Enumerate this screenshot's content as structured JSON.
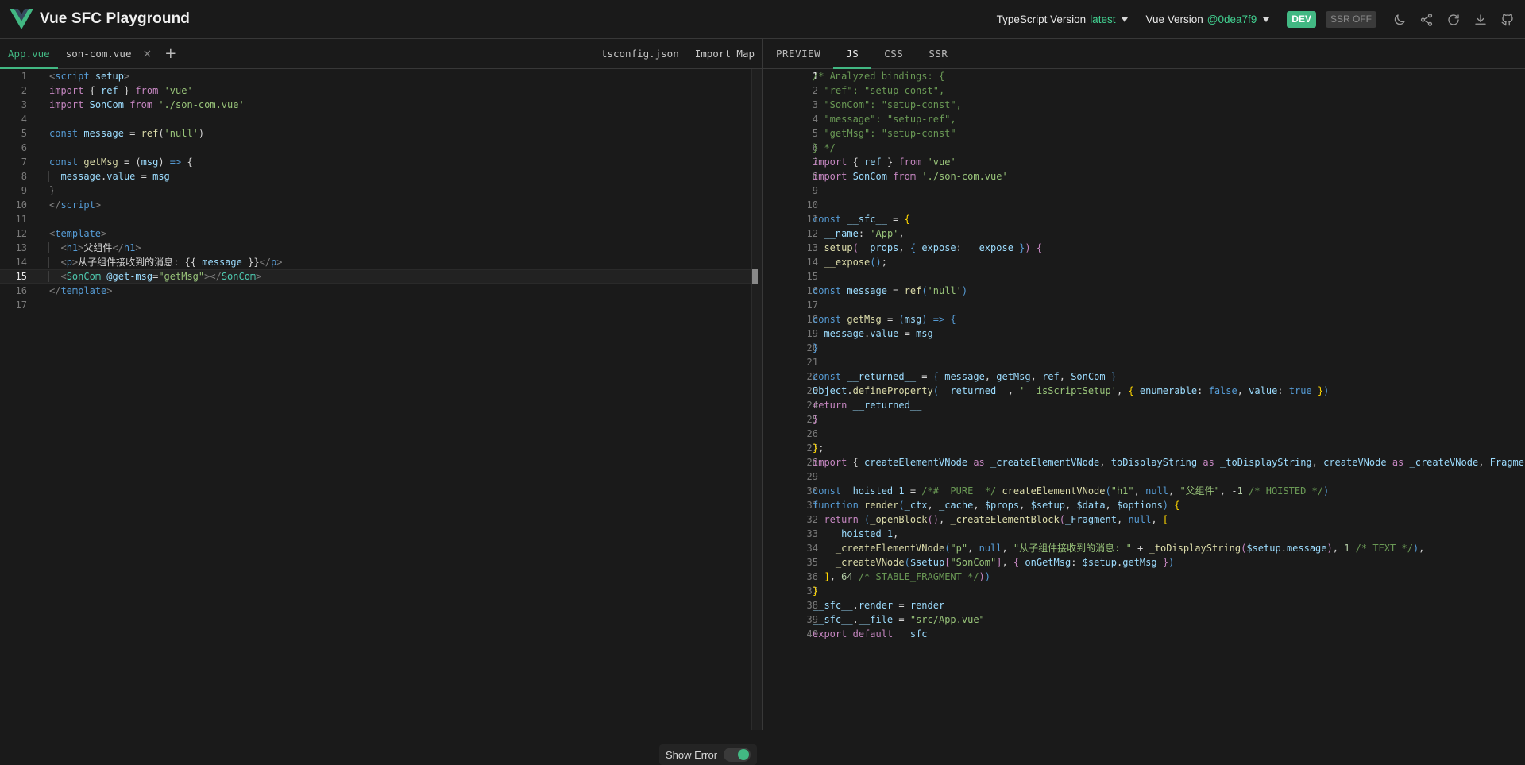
{
  "app": {
    "title": "Vue SFC Playground",
    "logo_icon": "vue-logo-icon"
  },
  "nav": {
    "ts_label": "TypeScript Version",
    "ts_value": "latest",
    "vue_label": "Vue Version",
    "vue_value": "@0dea7f9",
    "dev_badge": "DEV",
    "ssr_badge": "SSR OFF",
    "icons": [
      "moon-icon",
      "share-icon",
      "reload-icon",
      "download-icon",
      "github-icon"
    ]
  },
  "editor": {
    "tabs": [
      {
        "label": "App.vue",
        "active": true
      },
      {
        "label": "son-com.vue",
        "active": false,
        "close": "×"
      }
    ],
    "add_label": "+",
    "right_tabs": [
      "tsconfig.json",
      "Import Map"
    ],
    "current_line": 15,
    "show_error_label": "Show Error",
    "show_error_on": true
  },
  "output": {
    "tabs": [
      "PREVIEW",
      "JS",
      "CSS",
      "SSR"
    ],
    "active_tab": "JS",
    "current_line": 1
  },
  "colors": {
    "accent": "#42b883",
    "background": "#1a1a1a",
    "border": "#383838"
  }
}
